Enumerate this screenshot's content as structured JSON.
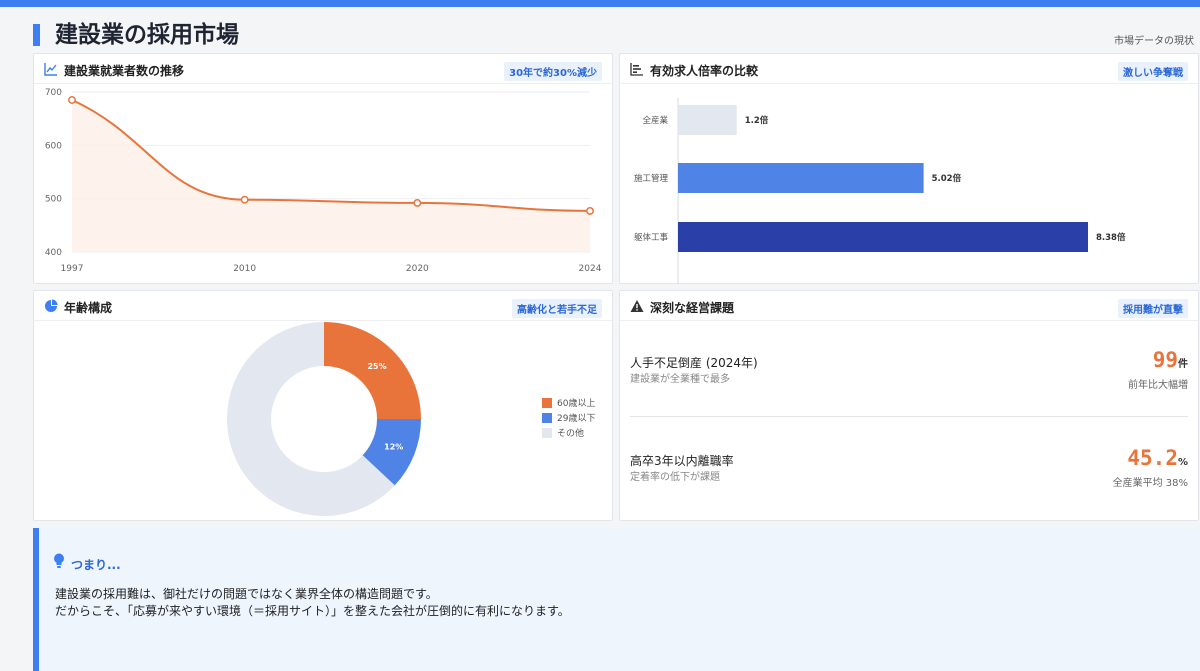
{
  "header": {
    "title": "建設業の採用市場",
    "subtitle": "市場データの現状"
  },
  "cards": {
    "workers": {
      "title": "建設業就業者数の推移",
      "badge": "30年で約30%減少",
      "icon": "line-chart-icon"
    },
    "ratio": {
      "title": "有効求人倍率の比較",
      "badge": "激しい争奪戦",
      "icon": "bar-chart-icon"
    },
    "age": {
      "title": "年齢構成",
      "badge": "高齢化と若手不足",
      "icon": "pie-chart-icon"
    },
    "issues": {
      "title": "深刻な経営課題",
      "badge": "採用難が直撃",
      "icon": "warning-icon"
    }
  },
  "issues": [
    {
      "name": "人手不足倒産 (2024年)",
      "desc": "建設業が全業種で最多",
      "value": "99",
      "unit": "件",
      "note": "前年比大幅増"
    },
    {
      "name": "高卒3年以内離職率",
      "desc": "定着率の低下が課題",
      "value": "45.2",
      "unit": "%",
      "note": "全産業平均 38%"
    }
  ],
  "summary": {
    "label": "つまり...",
    "line1": "建設業の採用難は、御社だけの問題ではなく業界全体の構造問題です。",
    "line2": "だからこそ、「応募が来やすい環境（＝採用サイト）」を整えた会社が圧倒的に有利になります。"
  },
  "colors": {
    "accent": "#3d7ef0",
    "orange": "#e8743b",
    "blue": "#4f83e6",
    "navy": "#2a3fa8",
    "gray": "#e3e8f0"
  },
  "chart_data": [
    {
      "type": "line",
      "x": [
        "1997",
        "2010",
        "2020",
        "2024"
      ],
      "series": [
        {
          "values": [
            685,
            498,
            492,
            477
          ]
        }
      ],
      "ylim": [
        400,
        700
      ],
      "yticks": [
        "400",
        "500",
        "600",
        "700"
      ]
    },
    {
      "type": "bar",
      "orientation": "horizontal",
      "categories": [
        "全産業",
        "施工管理",
        "躯体工事"
      ],
      "values": [
        1.2,
        5.02,
        8.38
      ],
      "labels": [
        "1.2倍",
        "5.02倍",
        "8.38倍"
      ],
      "colors": [
        "#e3e8f0",
        "#4f83e6",
        "#2a3fa8"
      ]
    },
    {
      "type": "pie",
      "donut": true,
      "categories": [
        "60歳以上",
        "29歳以下",
        "その他"
      ],
      "values": [
        25,
        12,
        63
      ],
      "labels": [
        "25%",
        "12%",
        ""
      ],
      "colors": [
        "#e8743b",
        "#4f83e6",
        "#e3e8f0"
      ]
    }
  ]
}
